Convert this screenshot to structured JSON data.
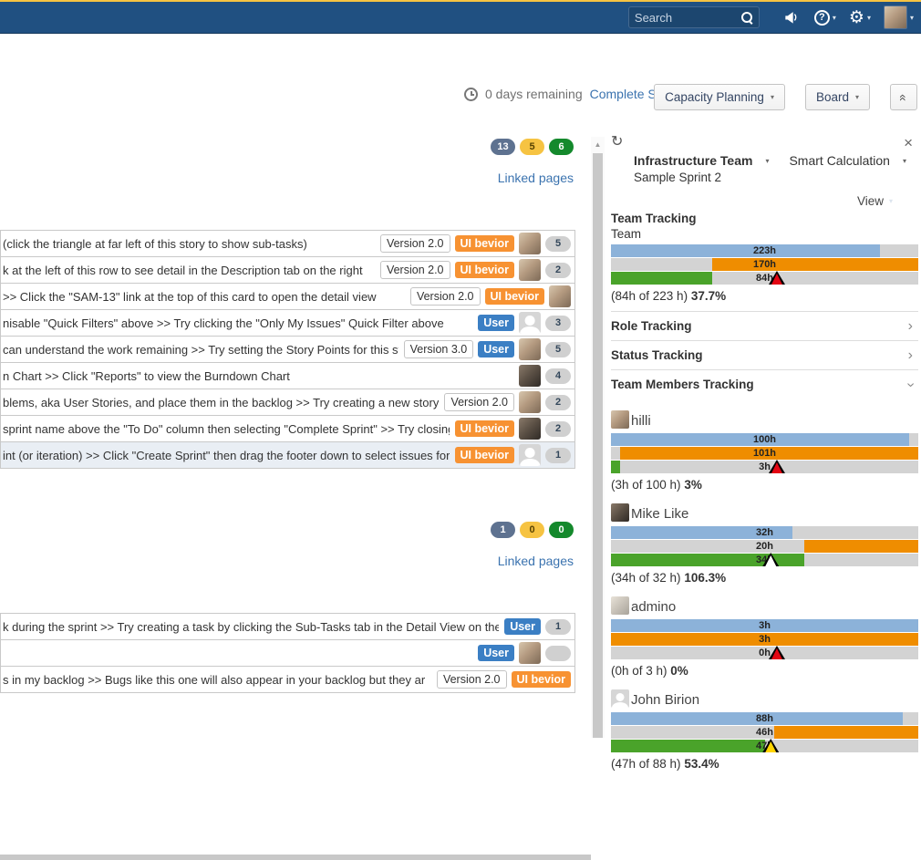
{
  "navbar": {
    "search_placeholder": "Search"
  },
  "header": {
    "days_remaining": "0 days remaining",
    "complete_sprint_label": "Complete Sprint",
    "capacity_planning_label": "Capacity Planning",
    "board_label": "Board",
    "collapse_label": "«"
  },
  "left": {
    "sections": [
      {
        "badges": [
          {
            "value": "13",
            "type": "todo"
          },
          {
            "value": "5",
            "type": "inprogress"
          },
          {
            "value": "6",
            "type": "done"
          }
        ],
        "linked_pages_label": "Linked pages",
        "rows": [
          {
            "text": "(click the triangle at far left of this story to show sub-tasks)",
            "tags": [
              {
                "text": "Version 2.0",
                "type": "version"
              },
              {
                "text": "UI bevior",
                "type": "orange"
              }
            ],
            "avatar": "man",
            "points": "5",
            "selected": false
          },
          {
            "text": "k at the left of this row to see detail in the Description tab on the right",
            "tags": [
              {
                "text": "Version 2.0",
                "type": "version"
              },
              {
                "text": "UI bevior",
                "type": "orange"
              }
            ],
            "avatar": "man",
            "points": "2",
            "selected": false
          },
          {
            "text": ">> Click the \"SAM-13\" link at the top of this card to open the detail view",
            "tags": [
              {
                "text": "Version 2.0",
                "type": "version"
              },
              {
                "text": "UI bevior",
                "type": "orange"
              }
            ],
            "avatar": "man",
            "points": null,
            "selected": false
          },
          {
            "text": "nisable \"Quick Filters\" above >> Try clicking the \"Only My Issues\" Quick Filter above",
            "tags": [
              {
                "text": "User",
                "type": "blue"
              }
            ],
            "avatar": "generic",
            "points": "3",
            "selected": false
          },
          {
            "text": " can understand the work remaining >> Try setting the Story Points for this story",
            "tags": [
              {
                "text": "Version 3.0",
                "type": "version"
              },
              {
                "text": "User",
                "type": "blue"
              }
            ],
            "avatar": "man",
            "points": "5",
            "selected": false
          },
          {
            "text": "n Chart >> Click \"Reports\" to view the Burndown Chart",
            "tags": [],
            "avatar": "dog",
            "points": "4",
            "selected": false
          },
          {
            "text": "blems, aka User Stories, and place them in the backlog >> Try creating a new story with",
            "tags": [
              {
                "text": "Version 2.0",
                "type": "version"
              }
            ],
            "avatar": "man",
            "points": "2",
            "selected": false
          },
          {
            "text": " sprint name above the \"To Do\" column then selecting \"Complete Sprint\" >> Try closing thi",
            "tags": [
              {
                "text": "UI bevior",
                "type": "orange"
              }
            ],
            "avatar": "dog",
            "points": "2",
            "selected": false
          },
          {
            "text": "int (or iteration) >> Click \"Create Sprint\" then drag the footer down to select issues for a sp",
            "tags": [
              {
                "text": "UI bevior",
                "type": "orange"
              }
            ],
            "avatar": "generic",
            "points": "1",
            "selected": true
          }
        ]
      },
      {
        "badges": [
          {
            "value": "1",
            "type": "todo"
          },
          {
            "value": "0",
            "type": "inprogress"
          },
          {
            "value": "0",
            "type": "done"
          }
        ],
        "linked_pages_label": "Linked pages",
        "rows": [
          {
            "text": "k during the sprint >> Try creating a task by clicking the Sub-Tasks tab in the Detail View on the rig",
            "tags": [
              {
                "text": "User",
                "type": "blue"
              }
            ],
            "avatar": null,
            "points": "1",
            "selected": false
          },
          {
            "text": "",
            "tags": [
              {
                "text": "User",
                "type": "blue"
              }
            ],
            "avatar": "man",
            "points": "",
            "selected": false
          },
          {
            "text": "s in my backlog >> Bugs like this one will also appear in your backlog but they ar",
            "tags": [
              {
                "text": "Version 2.0",
                "type": "version"
              },
              {
                "text": "UI bevior",
                "type": "orange"
              }
            ],
            "avatar": null,
            "points": null,
            "selected": false
          }
        ]
      }
    ]
  },
  "panel": {
    "team_selector": "Infrastructure Team",
    "calculation_selector": "Smart Calculation",
    "sprint_name": "Sample Sprint 2",
    "view_label": "View",
    "team_tracking_title": "Team Tracking",
    "team_label": "Team",
    "team_bars": [
      {
        "kind": "estimate",
        "label": "223h",
        "pct": 87.5
      },
      {
        "kind": "remaining",
        "label": "170h",
        "start_pct": 33
      },
      {
        "kind": "logged",
        "label": "84h",
        "pct": 33,
        "marker_pct": 54,
        "marker_color": "red"
      }
    ],
    "team_summary": "(84h of 223 h) ",
    "team_pct": "37.7%",
    "role_tracking_title": "Role Tracking",
    "status_tracking_title": "Status Tracking",
    "members_title": "Team Members Tracking",
    "members": [
      {
        "name": "hilli",
        "avatar": "man",
        "bars": [
          {
            "kind": "estimate",
            "label": "100h",
            "pct": 97
          },
          {
            "kind": "remaining",
            "label": "101h",
            "start_pct": 3
          },
          {
            "kind": "logged",
            "label": "3h",
            "pct": 3,
            "marker_pct": 54,
            "marker_color": "red"
          }
        ],
        "summary": "(3h of 100 h) ",
        "pct": "3%"
      },
      {
        "name": "Mike Like",
        "avatar": "dog",
        "bars": [
          {
            "kind": "estimate",
            "label": "32h",
            "pct": 59
          },
          {
            "kind": "remaining",
            "label": "20h",
            "start_pct": 63
          },
          {
            "kind": "logged",
            "label": "34h",
            "pct": 63,
            "marker_pct": 52,
            "marker_color": "white"
          }
        ],
        "summary": "(34h of 32 h) ",
        "pct": "106.3%"
      },
      {
        "name": "admino",
        "avatar": "man2",
        "bars": [
          {
            "kind": "estimate",
            "label": "3h",
            "pct": 100
          },
          {
            "kind": "remaining",
            "label": "3h",
            "start_pct": 0
          },
          {
            "kind": "logged",
            "label": "0h",
            "pct": 0,
            "marker_pct": 54,
            "marker_color": "red"
          }
        ],
        "summary": "(0h of 3 h) ",
        "pct": "0%"
      },
      {
        "name": "John Birion",
        "avatar": "generic",
        "bars": [
          {
            "kind": "estimate",
            "label": "88h",
            "pct": 95
          },
          {
            "kind": "remaining",
            "label": "46h",
            "start_pct": 53
          },
          {
            "kind": "logged",
            "label": "47h",
            "pct": 50,
            "marker_pct": 52,
            "marker_color": "yellow"
          }
        ],
        "summary": "(47h of 88 h) ",
        "pct": "53.4%"
      }
    ]
  },
  "colors": {
    "navbar": "#205081",
    "top_strip": "#f6c342",
    "link": "#3b73af",
    "orange_label": "#f79232",
    "blue_label": "#3b7fc4",
    "bar_blue": "#8cb2d9",
    "bar_orange": "#ef8d00",
    "bar_green": "#4aa32a",
    "bar_gray": "#d3d3d3",
    "marker_red": "#e30613",
    "marker_white": "#ffffff",
    "marker_yellow": "#ffd500"
  }
}
